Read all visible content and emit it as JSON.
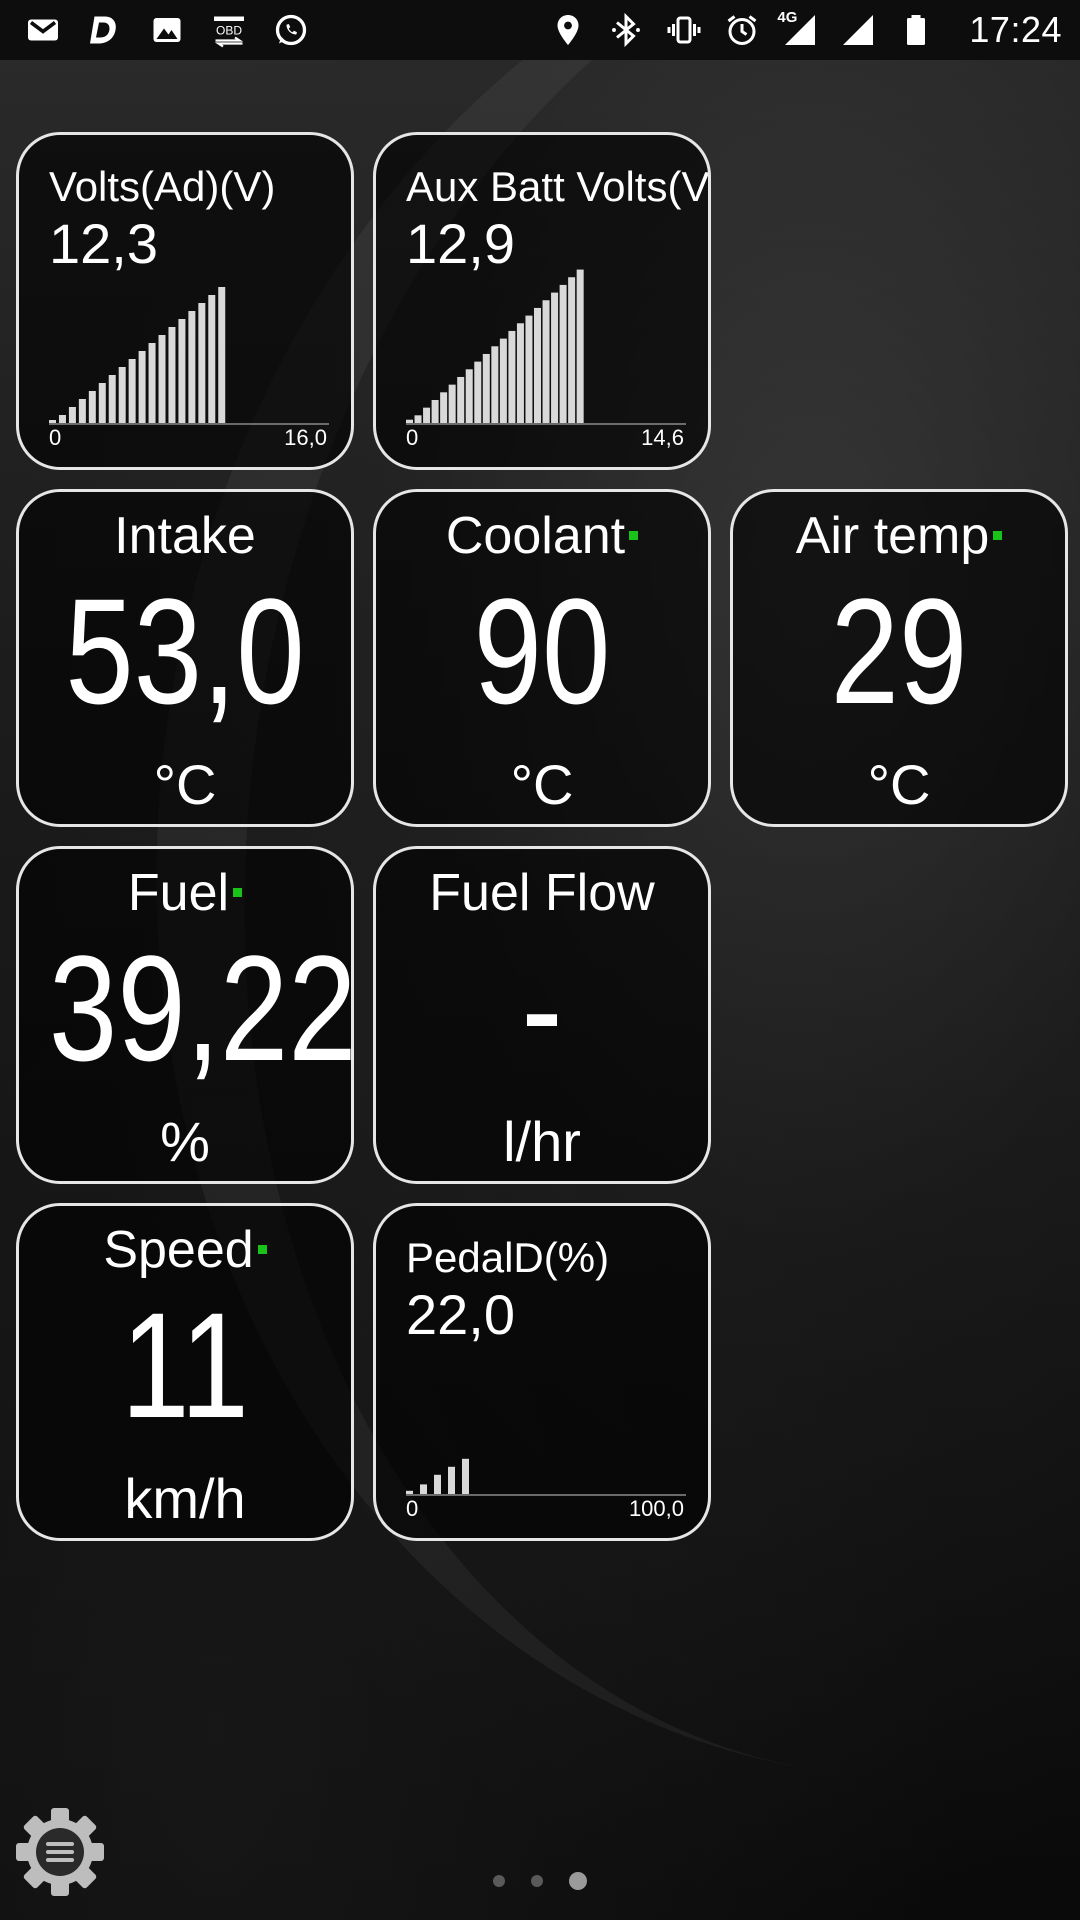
{
  "status_bar": {
    "time": "17:24",
    "network": "4G",
    "left_icons": [
      "gmail-icon",
      "d-app-icon",
      "image-icon",
      "obd-icon",
      "whatsapp-icon"
    ],
    "right_icons": [
      "location-icon",
      "bluetooth-icon",
      "vibrate-icon",
      "alarm-icon",
      "signal-4g-icon",
      "signal-icon",
      "battery-icon"
    ]
  },
  "gauges": {
    "volts_ad": {
      "title": "Volts(Ad)(V)",
      "value": "12,3",
      "min": "0",
      "max": "16,0"
    },
    "aux_batt": {
      "title": "Aux Batt Volts(V)",
      "value": "12,9",
      "min": "0",
      "max": "14,6"
    },
    "intake": {
      "title": "Intake",
      "value": "53,0",
      "unit": "°C"
    },
    "coolant": {
      "title": "Coolant",
      "value": "90",
      "unit": "°C"
    },
    "air_temp": {
      "title": "Air temp",
      "value": "29",
      "unit": "°C"
    },
    "fuel": {
      "title": "Fuel",
      "value": "39,22",
      "unit": "%"
    },
    "fuel_flow": {
      "title": "Fuel Flow",
      "value": "-",
      "unit": "l/hr"
    },
    "speed": {
      "title": "Speed",
      "value": "11",
      "unit": "km/h"
    },
    "pedal": {
      "title": "PedalD(%)",
      "value": "22,0",
      "min": "0",
      "max": "100,0"
    }
  },
  "history": {
    "volts_ad": [
      0.3,
      0.8,
      1.6,
      2.4,
      3.2,
      4.0,
      4.8,
      5.6,
      6.4,
      7.2,
      8.0,
      8.8,
      9.6,
      10.4,
      11.2,
      12.0,
      12.8,
      13.6
    ],
    "aux_batt": [
      0.3,
      0.7,
      1.4,
      2.1,
      2.8,
      3.5,
      4.2,
      4.9,
      5.6,
      6.3,
      7.0,
      7.7,
      8.4,
      9.1,
      9.8,
      10.5,
      11.2,
      11.9,
      12.6,
      13.3,
      14.0
    ],
    "pedal": [
      2,
      6,
      12,
      17,
      22
    ]
  },
  "pager": {
    "pages": 3,
    "active": 2
  },
  "colors": {
    "accent_dot": "#19c319",
    "tile_border": "#e6e6e6",
    "bars": "#d9d9d9"
  }
}
